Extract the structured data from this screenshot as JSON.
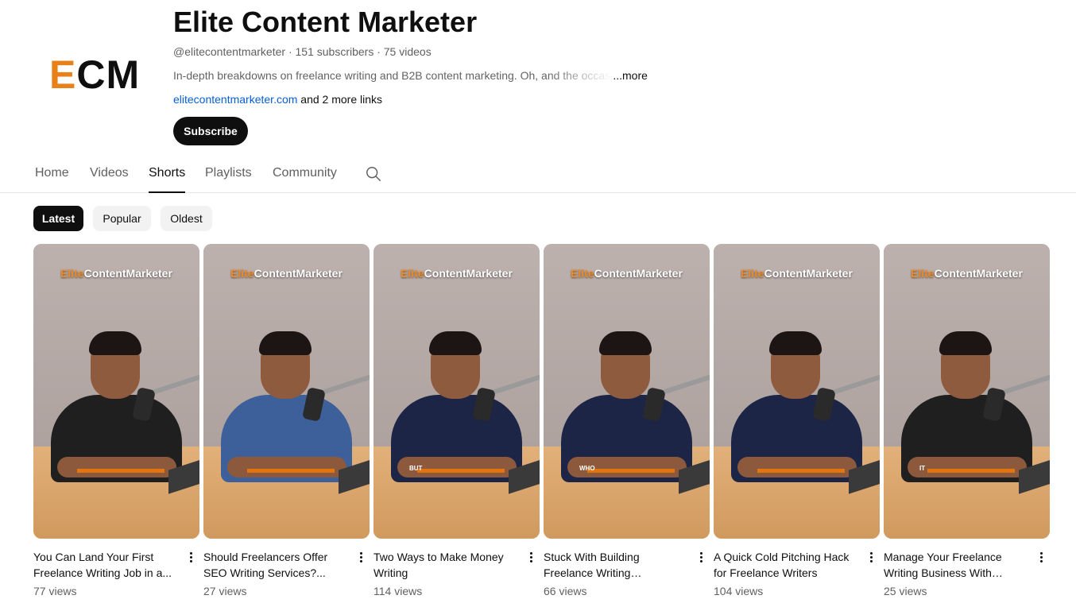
{
  "channel": {
    "logo_e": "E",
    "logo_rest": "CM",
    "title": "Elite Content Marketer",
    "meta": "@elitecontentmarketer · 151 subscribers · 75 videos",
    "description": "In-depth breakdowns on freelance writing and B2B content marketing. Oh, and the occasi",
    "description_more": "...more",
    "link": "elitecontentmarketer.com",
    "more_links": " and 2 more links",
    "subscribe_label": "Subscribe"
  },
  "tabs": [
    {
      "label": "Home"
    },
    {
      "label": "Videos"
    },
    {
      "label": "Shorts",
      "active": true
    },
    {
      "label": "Playlists"
    },
    {
      "label": "Community"
    }
  ],
  "search_icon": "search-icon",
  "chips": [
    {
      "label": "Latest",
      "active": true
    },
    {
      "label": "Popular"
    },
    {
      "label": "Oldest"
    }
  ],
  "thumb_brand": {
    "part1": "Elite",
    "part2": "ContentMarketer"
  },
  "shorts": [
    {
      "title": "You Can Land Your First Freelance Writing Job in a...",
      "views": "77 views",
      "shirt": "#1f1f1f",
      "caption": ""
    },
    {
      "title": "Should Freelancers Offer SEO Writing Services?...",
      "views": "27 views",
      "shirt": "#3d5f9a",
      "caption": ""
    },
    {
      "title": "Two Ways to Make Money Writing",
      "views": "114 views",
      "shirt": "#1c2545",
      "caption": "BUT"
    },
    {
      "title": "Stuck With Building Freelance Writing Portfolio?...",
      "views": "66 views",
      "shirt": "#1c2545",
      "caption": "WHO"
    },
    {
      "title": "A Quick Cold Pitching Hack for Freelance Writers",
      "views": "104 views",
      "shirt": "#1c2545",
      "caption": ""
    },
    {
      "title": "Manage Your Freelance Writing Business With Thes...",
      "views": "25 views",
      "shirt": "#1f1f1f",
      "caption": "IT"
    }
  ],
  "colors": {
    "accent_orange": "#e8811a",
    "link_blue": "#065fd4",
    "caption_bar": "#e37511"
  }
}
